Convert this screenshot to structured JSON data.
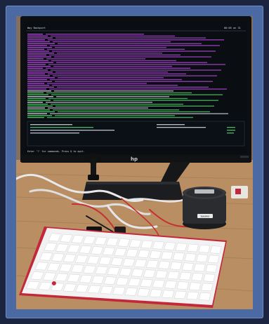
{
  "photo": {
    "subject": "Desktop setup with a monitor, speaker, and keyboard",
    "screen": {
      "header_left": "Wqy Backport",
      "header_right": "00:05 on 31",
      "footer_hint": "Enter '?' for commands. Press Q to quit.",
      "brand": "hp"
    },
    "speaker_label": "Speaker"
  },
  "colors": {
    "border": "#4b6aa3",
    "page": "#1b2540",
    "screen_bg": "#0a0e12",
    "console_magenta": "#b64ce0",
    "console_green": "#57d36e",
    "console_white": "#d9dde8",
    "keyboard_white": "#f2f2f2",
    "keyboard_red": "#c3273a",
    "desk": "#b98e62"
  }
}
